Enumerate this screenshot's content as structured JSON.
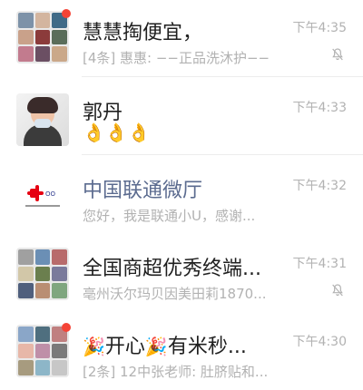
{
  "chats": [
    {
      "title": "慧慧掏便宜，",
      "preview": "[4条] 惠惠: −−正品洗沐护−−",
      "time": "下午4:35",
      "muted": true,
      "unread_dot": true,
      "avatar": "group-avatar"
    },
    {
      "title": "郭丹",
      "preview": "👌👌👌",
      "time": "下午4:33",
      "muted": false,
      "unread_dot": false,
      "avatar": "person-avatar"
    },
    {
      "title": "中国联通微厅",
      "preview": "您好，我是联通小U，感谢...",
      "time": "下午4:32",
      "muted": false,
      "unread_dot": false,
      "avatar": "china-unicom-logo"
    },
    {
      "title": "全国商超优秀终端...",
      "preview": "亳州沃尔玛贝因美田莉1870...",
      "time": "下午4:31",
      "muted": true,
      "unread_dot": false,
      "avatar": "group-avatar"
    },
    {
      "title_parts": [
        "🎉",
        "开心",
        "🎉",
        "有米秒..."
      ],
      "preview": "[2条] 12中张老师: 肚脐贴和...",
      "time": "下午4:30",
      "muted": false,
      "unread_dot": true,
      "avatar": "group-avatar"
    }
  ],
  "colors": {
    "title": "#1f1f1f",
    "official_title": "#5b6b8f",
    "meta": "#b2b2b2",
    "badge": "#f44336",
    "divider": "#ececec"
  },
  "icons": {
    "mute": "bell-slash-icon"
  }
}
